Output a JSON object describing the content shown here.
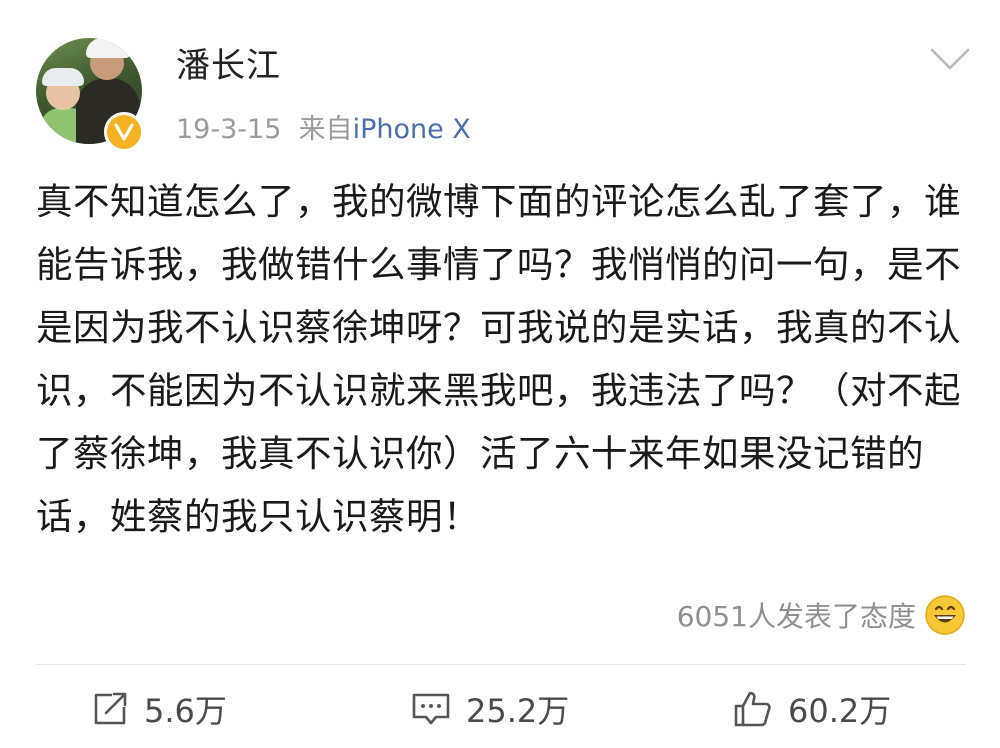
{
  "post": {
    "author": {
      "name": "潘长江",
      "verified": true,
      "verified_color": "#f5b223"
    },
    "date": "19-3-15",
    "source_prefix": "来自",
    "source": "iPhone X",
    "menu_icon": "chevron-down-icon",
    "text": "真不知道怎么了，我的微博下面的评论怎么乱了套了，谁能告诉我，我做错什么事情了吗？我悄悄的问一句，是不是因为我不认识蔡徐坤呀？可我说的是实话，我真的不认识，不能因为不认识就来黑我吧，我违法了吗？（对不起了蔡徐坤，我真不认识你）活了六十来年如果没记错的话，姓蔡的我只认识蔡明！",
    "reactions": {
      "text": "6051人发表了态度",
      "emoji": "grinning-face-emoji"
    },
    "actions": {
      "repost": {
        "icon": "repost-icon",
        "label": "5.6万"
      },
      "comment": {
        "icon": "comment-icon",
        "label": "25.2万"
      },
      "like": {
        "icon": "thumbs-up-icon",
        "label": "60.2万"
      }
    }
  }
}
